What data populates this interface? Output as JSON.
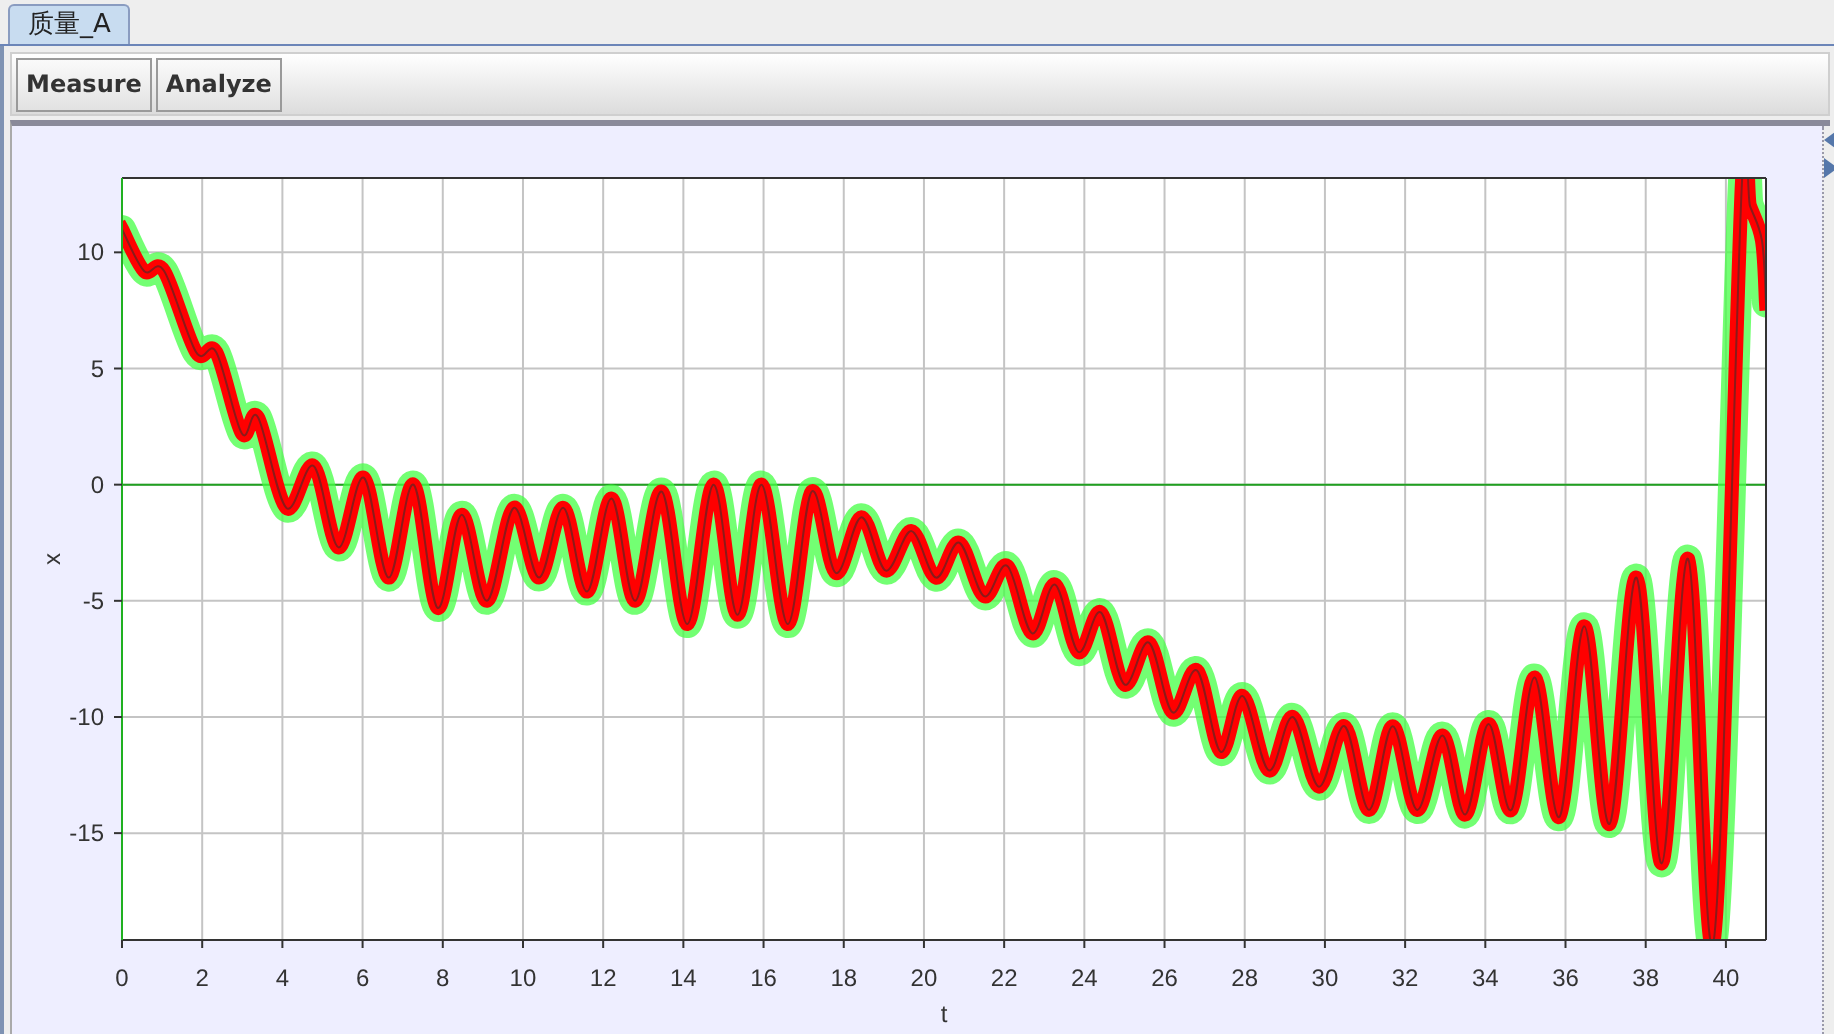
{
  "tabs": [
    {
      "label": "质量_A",
      "selected": true
    }
  ],
  "toolbar": {
    "buttons": [
      "Measure",
      "Analyze"
    ]
  },
  "chart": {
    "chart_data": {
      "type": "line",
      "xlabel": "t",
      "ylabel": "x",
      "xlim": [
        0,
        41
      ],
      "ylim": [
        -19.6,
        13.2
      ],
      "xticks": [
        0,
        2,
        4,
        6,
        8,
        10,
        12,
        14,
        16,
        18,
        20,
        22,
        24,
        26,
        28,
        30,
        32,
        34,
        36,
        38,
        40
      ],
      "yticks": [
        -15,
        -10,
        -5,
        0,
        5,
        10
      ],
      "grid": true,
      "ref_lines": [
        {
          "axis": "y",
          "value": 0,
          "color": "#20a020"
        }
      ],
      "x": [
        0,
        0.55,
        1.05,
        1.85,
        2.35,
        2.99,
        3.39,
        4.1,
        4.78,
        5.4,
        6.03,
        6.65,
        7.27,
        7.87,
        8.47,
        9.1,
        9.77,
        10.4,
        11.01,
        11.6,
        12.21,
        12.8,
        13.46,
        14.1,
        14.75,
        15.35,
        15.95,
        16.6,
        17.2,
        17.8,
        18.44,
        19.05,
        19.69,
        20.3,
        20.88,
        21.5,
        22.08,
        22.7,
        23.27,
        23.85,
        24.41,
        25.0,
        25.61,
        26.2,
        26.81,
        27.4,
        27.95,
        28.6,
        29.2,
        29.85,
        30.49,
        31.1,
        31.69,
        32.3,
        32.93,
        33.5,
        34.08,
        34.65,
        35.23,
        35.85,
        36.47,
        37.1,
        37.77,
        38.4,
        39.06,
        39.7,
        40.4,
        40.6,
        40.9,
        41.0
      ],
      "series": [
        {
          "color": "#ff0000",
          "values": [
            11,
            9.2,
            9.2,
            5.7,
            5.7,
            2.2,
            2.9,
            -1,
            0.8,
            -2.7,
            0.3,
            -4,
            0,
            -5.3,
            -1.3,
            -5,
            -1,
            -4,
            -1,
            -4.6,
            -0.6,
            -5,
            -0.3,
            -6,
            0,
            -5.6,
            0,
            -6,
            -0.3,
            -3.8,
            -1.4,
            -3.7,
            -2,
            -4,
            -2.5,
            -4.8,
            -3.5,
            -6.4,
            -4.3,
            -7.2,
            -5.5,
            -8.6,
            -6.8,
            -9.8,
            -8,
            -11.5,
            -9.1,
            -12.3,
            -10,
            -13,
            -10.4,
            -14,
            -10.4,
            -14,
            -10.8,
            -14.2,
            -10.3,
            -14,
            -8.3,
            -14.3,
            -6.1,
            -14.6,
            -4.0,
            -16.3,
            -3.2,
            -19.6,
            13,
            12,
            10.5,
            7.8
          ]
        }
      ]
    }
  }
}
